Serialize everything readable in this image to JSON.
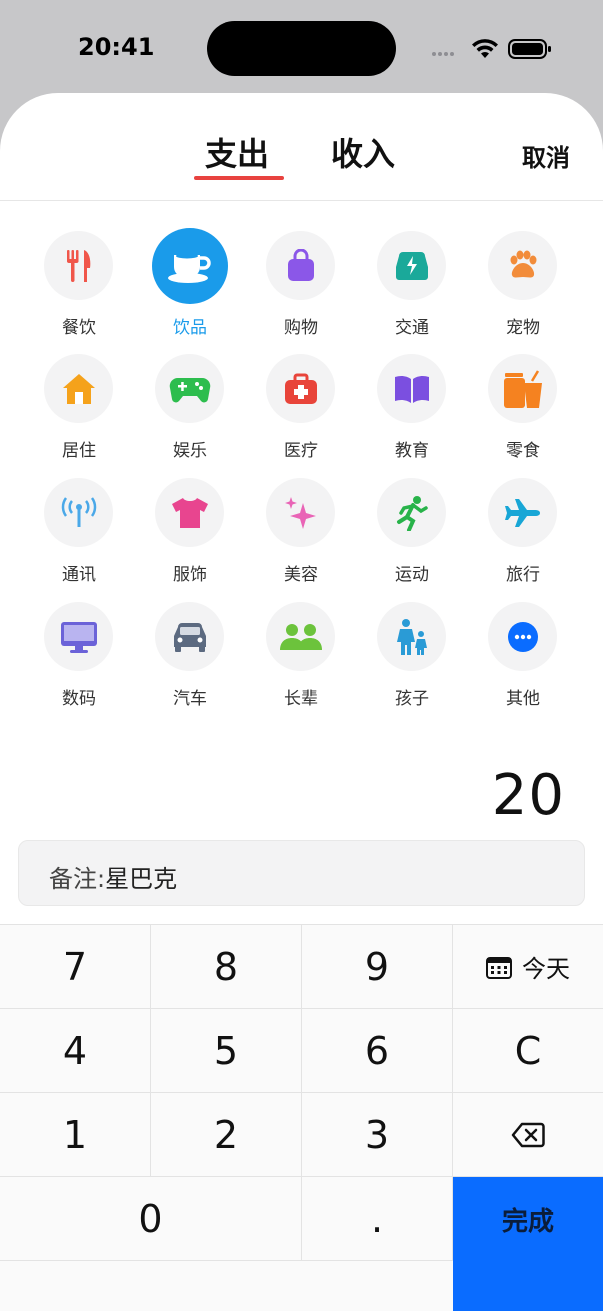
{
  "status_bar": {
    "time": "20:41"
  },
  "tabs": {
    "expense": "支出",
    "income": "收入",
    "cancel": "取消"
  },
  "categories": [
    {
      "label": "餐饮",
      "icon": "fork-knife-icon",
      "color": "#f0564a"
    },
    {
      "label": "饮品",
      "icon": "coffee-cup-icon",
      "color": "#ffffff",
      "selected": true
    },
    {
      "label": "购物",
      "icon": "shopping-bag-icon",
      "color": "#8b57e8"
    },
    {
      "label": "交通",
      "icon": "car-bolt-icon",
      "color": "#1aa99a"
    },
    {
      "label": "宠物",
      "icon": "paw-icon",
      "color": "#f28c3a"
    },
    {
      "label": "居住",
      "icon": "house-icon",
      "color": "#f5a21b"
    },
    {
      "label": "娱乐",
      "icon": "gamepad-icon",
      "color": "#2dbd4e"
    },
    {
      "label": "医疗",
      "icon": "medical-kit-icon",
      "color": "#e8443a"
    },
    {
      "label": "教育",
      "icon": "book-icon",
      "color": "#7b4fe0"
    },
    {
      "label": "零食",
      "icon": "snack-icon",
      "color": "#f58220"
    },
    {
      "label": "通讯",
      "icon": "antenna-icon",
      "color": "#4aa8e8"
    },
    {
      "label": "服饰",
      "icon": "tshirt-icon",
      "color": "#e8458f"
    },
    {
      "label": "美容",
      "icon": "sparkles-icon",
      "color": "#e964b6"
    },
    {
      "label": "运动",
      "icon": "running-icon",
      "color": "#28b34a"
    },
    {
      "label": "旅行",
      "icon": "airplane-icon",
      "color": "#18a6d6"
    },
    {
      "label": "数码",
      "icon": "monitor-icon",
      "color": "#6b62d8"
    },
    {
      "label": "汽车",
      "icon": "car-icon",
      "color": "#5c6a80"
    },
    {
      "label": "长辈",
      "icon": "people-icon",
      "color": "#6cc33c"
    },
    {
      "label": "孩子",
      "icon": "family-icon",
      "color": "#2a9bd6"
    },
    {
      "label": "其他",
      "icon": "more-icon",
      "color": "#0a6cff"
    }
  ],
  "amount": "20",
  "note": {
    "prefix": "备注:",
    "value": "星巴克"
  },
  "keypad": {
    "k7": "7",
    "k8": "8",
    "k9": "9",
    "today": "今天",
    "k4": "4",
    "k5": "5",
    "k6": "6",
    "clear": "C",
    "k1": "1",
    "k2": "2",
    "k3": "3",
    "k0": "0",
    "dot": ".",
    "done": "完成"
  },
  "colors": {
    "accent": "#1a9bea",
    "tab_underline": "#e8423f",
    "done_button": "#0a6cff"
  }
}
